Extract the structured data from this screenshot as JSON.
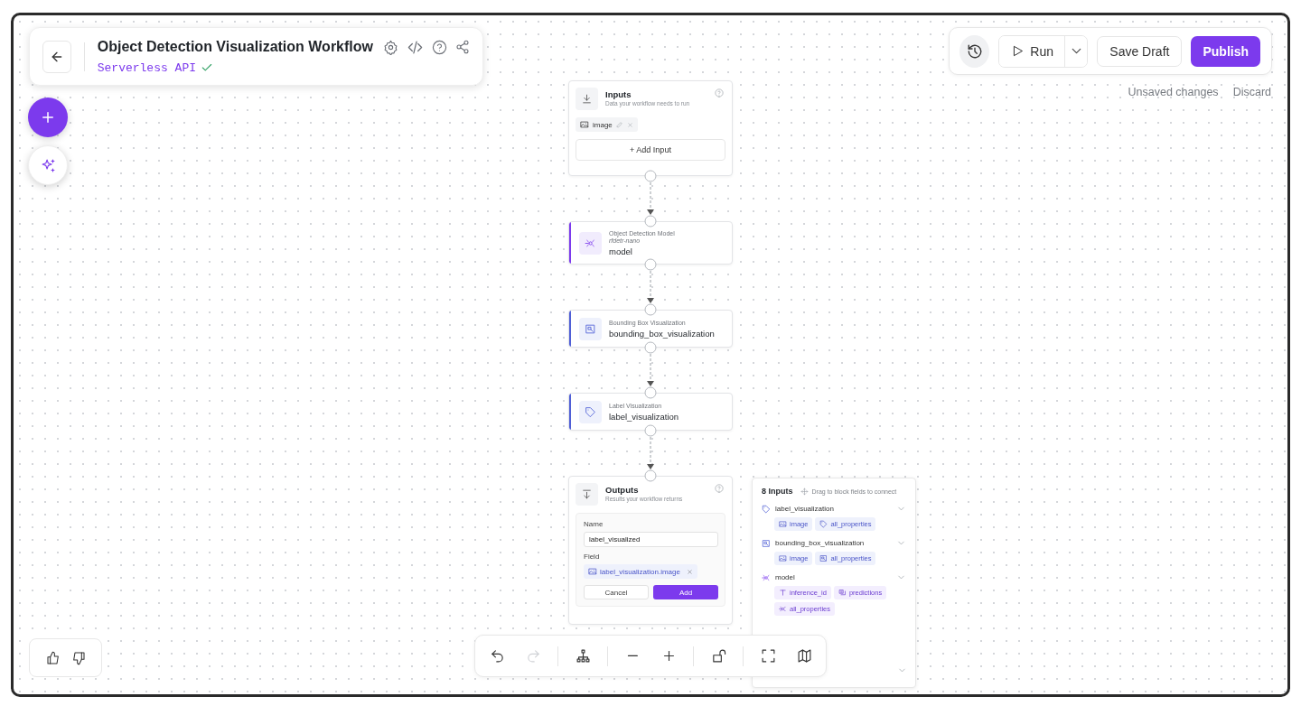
{
  "header": {
    "title": "Object Detection Visualization Workflow",
    "subtitle": "Serverless API",
    "deployed": true
  },
  "actions": {
    "run": "Run",
    "save": "Save Draft",
    "publish": "Publish",
    "status": "Unsaved changes",
    "discard": "Discard"
  },
  "nodes": [
    {
      "kind": "inputs",
      "title": "Inputs",
      "subtitle": "Data your workflow needs to run",
      "fields": [
        {
          "label": "image"
        }
      ],
      "add_label": "+ Add Input"
    },
    {
      "kind": "model",
      "type": "Object Detection Model",
      "model": "rfdetr-nano",
      "name": "model",
      "color": "#7c3aed"
    },
    {
      "kind": "bbox",
      "type": "Bounding Box Visualization",
      "name": "bounding_box_visualization",
      "color": "#4f5fd6"
    },
    {
      "kind": "tag",
      "type": "Label Visualization",
      "name": "label_visualization",
      "color": "#4f5fd6"
    },
    {
      "kind": "outputs",
      "title": "Outputs",
      "subtitle": "Results your workflow returns",
      "form": {
        "name_label": "Name",
        "name_value": "label_visualized",
        "field_label": "Field",
        "field_value": "label_visualization.image",
        "cancel": "Cancel",
        "add": "Add"
      }
    }
  ],
  "inputs_panel": {
    "title": "8 Inputs",
    "hint": "Drag to block fields to connect",
    "groups": [
      {
        "kind": "tag",
        "name": "label_visualization",
        "chips": [
          {
            "kind": "image",
            "label": "image"
          },
          {
            "kind": "tag",
            "label": "all_properties"
          }
        ]
      },
      {
        "kind": "bbox",
        "name": "bounding_box_visualization",
        "chips": [
          {
            "kind": "image",
            "label": "image"
          },
          {
            "kind": "bbox",
            "label": "all_properties"
          }
        ]
      },
      {
        "kind": "model",
        "name": "model",
        "chips": [
          {
            "kind": "text",
            "label": "inference_id"
          },
          {
            "kind": "list",
            "label": "predictions"
          },
          {
            "kind": "model",
            "label": "all_properties"
          }
        ]
      }
    ]
  },
  "toolbar": [
    [
      {
        "kind": "undo",
        "disabled": false
      },
      {
        "kind": "redo",
        "disabled": true
      }
    ],
    [
      {
        "kind": "layout",
        "disabled": false
      }
    ],
    [
      {
        "kind": "minus",
        "disabled": false
      },
      {
        "kind": "plus",
        "disabled": false
      }
    ],
    [
      {
        "kind": "unlock",
        "disabled": false
      }
    ],
    [
      {
        "kind": "fullscreen",
        "disabled": false
      },
      {
        "kind": "map",
        "disabled": false
      }
    ]
  ]
}
